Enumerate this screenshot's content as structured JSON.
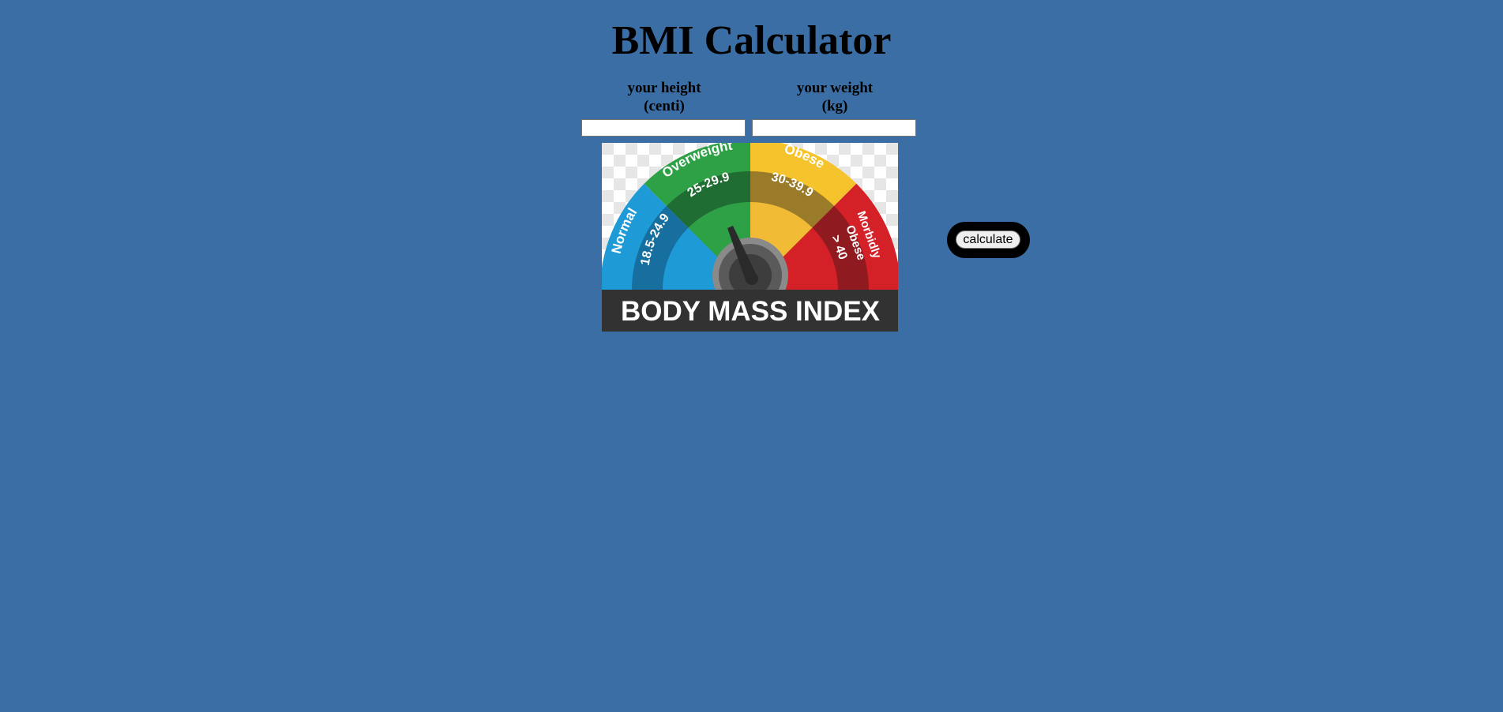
{
  "page": {
    "title": "BMI Calculator",
    "background_color": "#3b6ea5"
  },
  "form": {
    "height": {
      "label_line1": "your height",
      "label_line2": "(centi)",
      "value": "",
      "placeholder": ""
    },
    "weight": {
      "label_line1": "your weight",
      "label_line2": "(kg)",
      "value": "",
      "placeholder": ""
    },
    "calculate_label": "calculate"
  },
  "gauge_image": {
    "banner": "BODY MASS INDEX",
    "segments": [
      {
        "name": "Normal",
        "range": "18.5-24.9",
        "color": "#1e9bd7"
      },
      {
        "name": "Overweight",
        "range": "25-29.9",
        "color": "#2ea147"
      },
      {
        "name": "Obese",
        "range": "30-39.9",
        "color": "#f5c32c"
      },
      {
        "name": "Morbidly Obese",
        "range": "> 40",
        "color": "#d42027"
      }
    ],
    "morbid_line1": "Morbidly",
    "morbid_line2": "Obese"
  }
}
